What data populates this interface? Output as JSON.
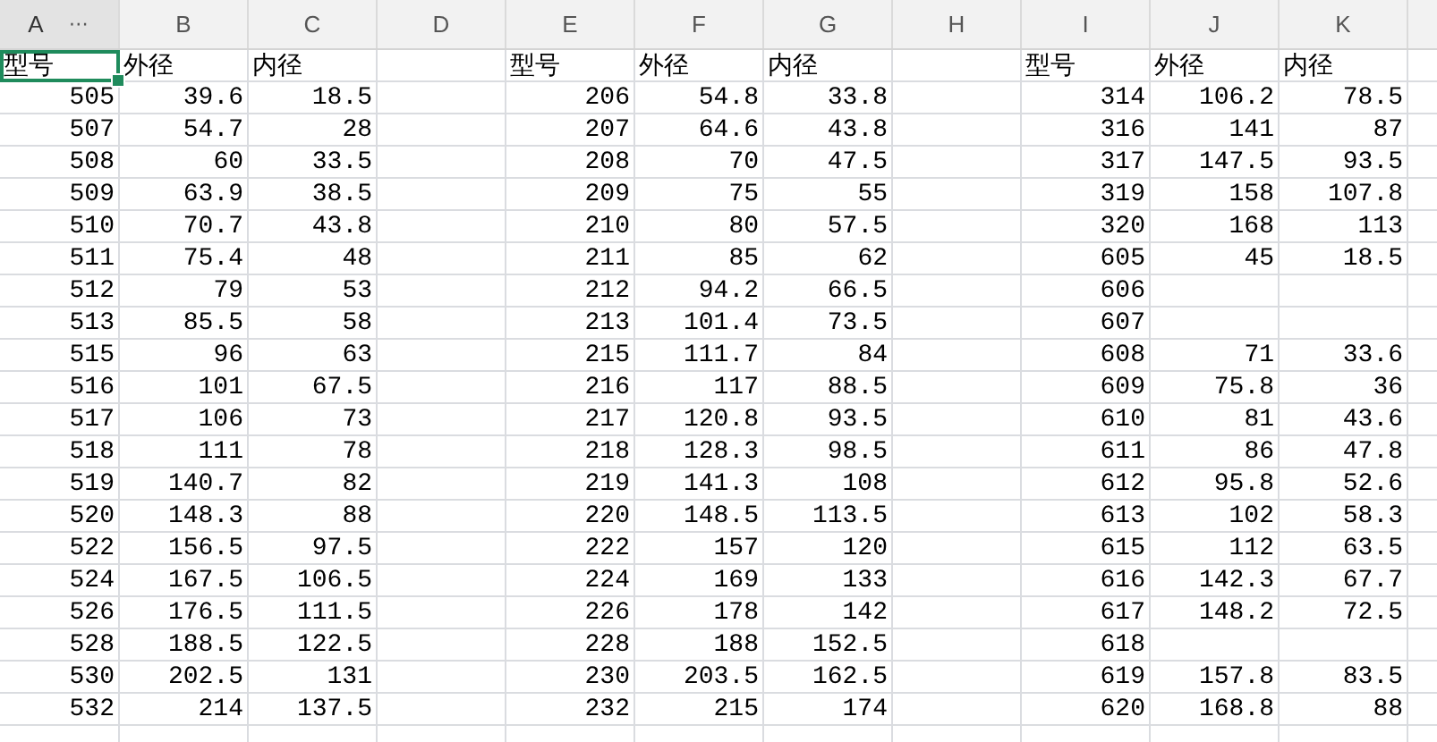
{
  "columns": [
    {
      "letter": "A",
      "menu": "⋯",
      "selected": true
    },
    {
      "letter": "B",
      "selected": false
    },
    {
      "letter": "C",
      "selected": false
    },
    {
      "letter": "D",
      "selected": false
    },
    {
      "letter": "E",
      "selected": false
    },
    {
      "letter": "F",
      "selected": false
    },
    {
      "letter": "G",
      "selected": false
    },
    {
      "letter": "H",
      "selected": false
    },
    {
      "letter": "I",
      "selected": false
    },
    {
      "letter": "J",
      "selected": false
    },
    {
      "letter": "K",
      "selected": false
    }
  ],
  "rows": [
    {
      "kind": "label",
      "selected": true,
      "cells": [
        "型号",
        "外径",
        "内径",
        null,
        "型号",
        "外径",
        "内径",
        null,
        "型号",
        "外径",
        "内径"
      ]
    },
    {
      "kind": "data",
      "selected": false,
      "cells": [
        "505",
        "39.6",
        "18.5",
        null,
        "206",
        "54.8",
        "33.8",
        null,
        "314",
        "106.2",
        "78.5"
      ]
    },
    {
      "kind": "data",
      "selected": false,
      "cells": [
        "507",
        "54.7",
        "28",
        null,
        "207",
        "64.6",
        "43.8",
        null,
        "316",
        "141",
        "87"
      ]
    },
    {
      "kind": "data",
      "selected": false,
      "cells": [
        "508",
        "60",
        "33.5",
        null,
        "208",
        "70",
        "47.5",
        null,
        "317",
        "147.5",
        "93.5"
      ]
    },
    {
      "kind": "data",
      "selected": false,
      "cells": [
        "509",
        "63.9",
        "38.5",
        null,
        "209",
        "75",
        "55",
        null,
        "319",
        "158",
        "107.8"
      ]
    },
    {
      "kind": "data",
      "selected": false,
      "cells": [
        "510",
        "70.7",
        "43.8",
        null,
        "210",
        "80",
        "57.5",
        null,
        "320",
        "168",
        "113"
      ]
    },
    {
      "kind": "data",
      "selected": false,
      "cells": [
        "511",
        "75.4",
        "48",
        null,
        "211",
        "85",
        "62",
        null,
        "605",
        "45",
        "18.5"
      ]
    },
    {
      "kind": "data",
      "selected": false,
      "cells": [
        "512",
        "79",
        "53",
        null,
        "212",
        "94.2",
        "66.5",
        null,
        "606",
        null,
        null
      ]
    },
    {
      "kind": "data",
      "selected": false,
      "cells": [
        "513",
        "85.5",
        "58",
        null,
        "213",
        "101.4",
        "73.5",
        null,
        "607",
        null,
        null
      ]
    },
    {
      "kind": "data",
      "selected": false,
      "cells": [
        "515",
        "96",
        "63",
        null,
        "215",
        "111.7",
        "84",
        null,
        "608",
        "71",
        "33.6"
      ]
    },
    {
      "kind": "data",
      "selected": false,
      "cells": [
        "516",
        "101",
        "67.5",
        null,
        "216",
        "117",
        "88.5",
        null,
        "609",
        "75.8",
        "36"
      ]
    },
    {
      "kind": "data",
      "selected": false,
      "cells": [
        "517",
        "106",
        "73",
        null,
        "217",
        "120.8",
        "93.5",
        null,
        "610",
        "81",
        "43.6"
      ]
    },
    {
      "kind": "data",
      "selected": false,
      "cells": [
        "518",
        "111",
        "78",
        null,
        "218",
        "128.3",
        "98.5",
        null,
        "611",
        "86",
        "47.8"
      ]
    },
    {
      "kind": "data",
      "selected": false,
      "cells": [
        "519",
        "140.7",
        "82",
        null,
        "219",
        "141.3",
        "108",
        null,
        "612",
        "95.8",
        "52.6"
      ]
    },
    {
      "kind": "data",
      "selected": false,
      "cells": [
        "520",
        "148.3",
        "88",
        null,
        "220",
        "148.5",
        "113.5",
        null,
        "613",
        "102",
        "58.3"
      ]
    },
    {
      "kind": "data",
      "selected": false,
      "cells": [
        "522",
        "156.5",
        "97.5",
        null,
        "222",
        "157",
        "120",
        null,
        "615",
        "112",
        "63.5"
      ]
    },
    {
      "kind": "data",
      "selected": false,
      "cells": [
        "524",
        "167.5",
        "106.5",
        null,
        "224",
        "169",
        "133",
        null,
        "616",
        "142.3",
        "67.7"
      ]
    },
    {
      "kind": "data",
      "selected": false,
      "cells": [
        "526",
        "176.5",
        "111.5",
        null,
        "226",
        "178",
        "142",
        null,
        "617",
        "148.2",
        "72.5"
      ]
    },
    {
      "kind": "data",
      "selected": false,
      "cells": [
        "528",
        "188.5",
        "122.5",
        null,
        "228",
        "188",
        "152.5",
        null,
        "618",
        null,
        null
      ]
    },
    {
      "kind": "data",
      "selected": false,
      "cells": [
        "530",
        "202.5",
        "131",
        null,
        "230",
        "203.5",
        "162.5",
        null,
        "619",
        "157.8",
        "83.5"
      ]
    },
    {
      "kind": "data",
      "selected": false,
      "cells": [
        "532",
        "214",
        "137.5",
        null,
        "232",
        "215",
        "174",
        null,
        "620",
        "168.8",
        "88"
      ]
    }
  ]
}
